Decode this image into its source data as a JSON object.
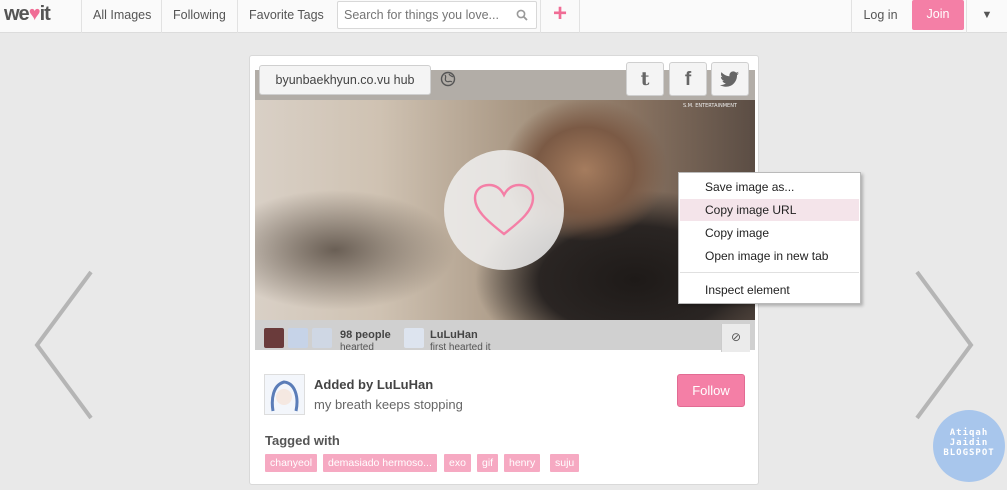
{
  "header": {
    "logo_text_a": "we",
    "logo_heart": "♥",
    "logo_text_b": "it",
    "nav": [
      {
        "label": "All Images"
      },
      {
        "label": "Following"
      },
      {
        "label": "Favorite Tags"
      }
    ],
    "search_placeholder": "Search for things you love...",
    "plus_label": "+",
    "login_label": "Log in",
    "join_label": "Join",
    "dropdown_label": "▼"
  },
  "card": {
    "source_label": "byunbaekhyun.co.vu hub",
    "share": {
      "tumblr": "t",
      "facebook": "f"
    },
    "watermark": "S.M. ENTERTAINMENT",
    "hearted": {
      "count_text": "98 people",
      "label": "hearted"
    },
    "first": {
      "name": "LuLuHan",
      "label": "first hearted it"
    },
    "flag_label": "⊘",
    "added_by": "Added by LuLuHan",
    "caption": "my breath keeps stopping",
    "follow_label": "Follow",
    "tagged_label": "Tagged with",
    "tags": [
      "chanyeol",
      "demasiado hermoso...",
      "exo",
      "gif",
      "henry",
      "suju"
    ]
  },
  "context_menu": {
    "items": [
      {
        "label": "Save image as..."
      },
      {
        "label": "Copy image URL"
      },
      {
        "label": "Copy image"
      },
      {
        "label": "Open image in new tab"
      },
      {
        "label": "Inspect element"
      }
    ],
    "highlighted_index": 1
  },
  "badge": {
    "line1": "Atiqah",
    "line2": "Jaidin",
    "line3": "BLOGSPOT"
  },
  "colors": {
    "accent": "#f47fa6",
    "tag": "#f6a9c2",
    "menu_highlight": "#f4e4ea"
  }
}
